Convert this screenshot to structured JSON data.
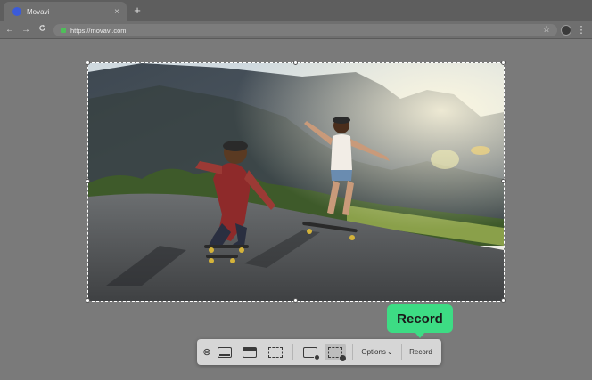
{
  "browser": {
    "tab_title": "Movavi",
    "tab_close": "×",
    "new_tab": "+",
    "url": "https://movavi.com",
    "back": "←",
    "forward": "→",
    "reload": "C",
    "star": "☆",
    "menu": "⋮"
  },
  "capture": {
    "image_desc": "skateboarders"
  },
  "toolbar": {
    "close": "⊗",
    "options_label": "Options",
    "options_caret": "⌄",
    "record_label": "Record"
  },
  "callout": {
    "label": "Record"
  },
  "colors": {
    "accent": "#3ddc84",
    "backdrop": "#7a7a7a"
  }
}
